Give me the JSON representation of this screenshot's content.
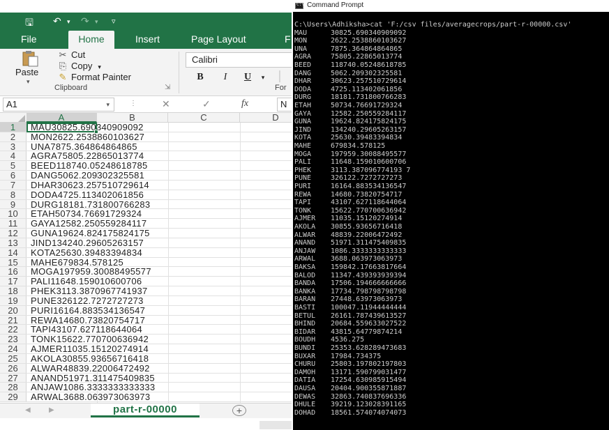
{
  "excel": {
    "qat": {
      "save_icon": "save-icon",
      "undo_icon": "undo-icon",
      "redo_icon": "redo-icon"
    },
    "tabs": [
      "File",
      "Home",
      "Insert",
      "Page Layout",
      "F"
    ],
    "clipboard": {
      "paste": "Paste",
      "cut": "Cut",
      "copy": "Copy",
      "format_painter": "Format Painter",
      "group_label": "Clipboard",
      "font_group_partial": "For"
    },
    "font": {
      "name": "Calibri",
      "bold": "B",
      "italic": "I",
      "underline": "U"
    },
    "formula_bar": {
      "name_box": "A1",
      "fx": "fx",
      "content": "N"
    },
    "columns": [
      "A",
      "B",
      "C",
      "D"
    ],
    "rows": [
      {
        "num": "1",
        "text": "MAU30825.690340909092"
      },
      {
        "num": "2",
        "text": "MON2622.2538860103627"
      },
      {
        "num": "3",
        "text": "UNA7875.364864864865"
      },
      {
        "num": "4",
        "text": "AGRA75805.22865013774"
      },
      {
        "num": "5",
        "text": "BEED118740.05248618785"
      },
      {
        "num": "6",
        "text": "DANG5062.209302325581"
      },
      {
        "num": "7",
        "text": "DHAR30623.257510729614"
      },
      {
        "num": "8",
        "text": "DODA4725.113402061856"
      },
      {
        "num": "9",
        "text": "DURG18181.731800766283"
      },
      {
        "num": "10",
        "text": "ETAH50734.76691729324"
      },
      {
        "num": "11",
        "text": "GAYA12582.250559284117"
      },
      {
        "num": "12",
        "text": "GUNA19624.824175824175"
      },
      {
        "num": "13",
        "text": "JIND134240.29605263157"
      },
      {
        "num": "14",
        "text": "KOTA25630.39483394834"
      },
      {
        "num": "15",
        "text": "MAHE679834.578125"
      },
      {
        "num": "16",
        "text": "MOGA197959.30088495577"
      },
      {
        "num": "17",
        "text": "PALI11648.159010600706"
      },
      {
        "num": "18",
        "text": "PHEK3113.3870967741937"
      },
      {
        "num": "19",
        "text": "PUNE326122.7272727273"
      },
      {
        "num": "20",
        "text": "PURI16164.883534136547"
      },
      {
        "num": "21",
        "text": "REWA14680.73820754717"
      },
      {
        "num": "22",
        "text": "TAPI43107.627118644064"
      },
      {
        "num": "23",
        "text": "TONK15622.770700636942"
      },
      {
        "num": "24",
        "text": "AJMER11035.15120274914"
      },
      {
        "num": "25",
        "text": "AKOLA30855.93656716418"
      },
      {
        "num": "26",
        "text": "ALWAR48839.22006472492"
      },
      {
        "num": "27",
        "text": "ANAND51971.311475409835"
      },
      {
        "num": "28",
        "text": "ANJAW1086.3333333333333"
      },
      {
        "num": "29",
        "text": "ARWAL3688.063973063973"
      }
    ],
    "sheet_tab": "part-r-00000",
    "add_sheet": "+"
  },
  "cmd": {
    "title": "Command Prompt",
    "icon_text": "C:\\",
    "command": "C:\\Users\\Adhiksha>cat 'F:/csv files/averagecrops/part-r-00000.csv'",
    "lines": [
      {
        "name": "MAU",
        "value": "30825.690340909092"
      },
      {
        "name": "MON",
        "value": "2622.2538860103627"
      },
      {
        "name": "UNA",
        "value": "7875.364864864865"
      },
      {
        "name": "AGRA",
        "value": "75805.22865013774"
      },
      {
        "name": "BEED",
        "value": "118740.05248618785"
      },
      {
        "name": "DANG",
        "value": "5062.209302325581"
      },
      {
        "name": "DHAR",
        "value": "30623.257510729614"
      },
      {
        "name": "DODA",
        "value": "4725.113402061856"
      },
      {
        "name": "DURG",
        "value": "18181.731800766283"
      },
      {
        "name": "ETAH",
        "value": "50734.76691729324"
      },
      {
        "name": "GAYA",
        "value": "12582.250559284117"
      },
      {
        "name": "GUNA",
        "value": "19624.824175824175"
      },
      {
        "name": "JIND",
        "value": "134240.29605263157"
      },
      {
        "name": "KOTA",
        "value": "25630.39483394834"
      },
      {
        "name": "MAHE",
        "value": "679834.578125"
      },
      {
        "name": "MOGA",
        "value": "197959.30088495577"
      },
      {
        "name": "PALI",
        "value": "11648.159010600706"
      },
      {
        "name": "PHEK",
        "value": "3113.387096774193 7"
      },
      {
        "name": "PUNE",
        "value": "326122.7272727273"
      },
      {
        "name": "PURI",
        "value": "16164.883534136547"
      },
      {
        "name": "REWA",
        "value": "14680.73820754717"
      },
      {
        "name": "TAPI",
        "value": "43107.627118644064"
      },
      {
        "name": "TONK",
        "value": "15622.770700636942"
      },
      {
        "name": "AJMER",
        "value": "11035.15120274914"
      },
      {
        "name": "AKOLA",
        "value": "30855.93656716418"
      },
      {
        "name": "ALWAR",
        "value": "48839.22006472492"
      },
      {
        "name": "ANAND",
        "value": "51971.311475409835"
      },
      {
        "name": "ANJAW",
        "value": "1086.3333333333333"
      },
      {
        "name": "ARWAL",
        "value": "3688.063973063973"
      },
      {
        "name": "BAKSA",
        "value": "159842.17663817664"
      },
      {
        "name": "BALOD",
        "value": "11347.439393939394"
      },
      {
        "name": "BANDA",
        "value": "17506.194666666666"
      },
      {
        "name": "BANKA",
        "value": "17734.798798798798"
      },
      {
        "name": "BARAN",
        "value": "27448.63973063973"
      },
      {
        "name": "BASTI",
        "value": "100047.11944444444"
      },
      {
        "name": "BETUL",
        "value": "26161.787439613527"
      },
      {
        "name": "BHIND",
        "value": "20684.559633027522"
      },
      {
        "name": "BIDAR",
        "value": "43815.64779874214"
      },
      {
        "name": "BOUDH",
        "value": "4536.275"
      },
      {
        "name": "BUNDI",
        "value": "25353.628289473683"
      },
      {
        "name": "BUXAR",
        "value": "17984.734375"
      },
      {
        "name": "CHURU",
        "value": "25803.197802197803"
      },
      {
        "name": "DAMOH",
        "value": "13171.590799031477"
      },
      {
        "name": "DATIA",
        "value": "17254.630985915494"
      },
      {
        "name": "DAUSA",
        "value": "20404.900355871887"
      },
      {
        "name": "DEWAS",
        "value": "32863.740837696336"
      },
      {
        "name": "DHULE",
        "value": "39219.123028391165"
      },
      {
        "name": "DOHAD",
        "value": "18561.574074074073"
      }
    ]
  }
}
